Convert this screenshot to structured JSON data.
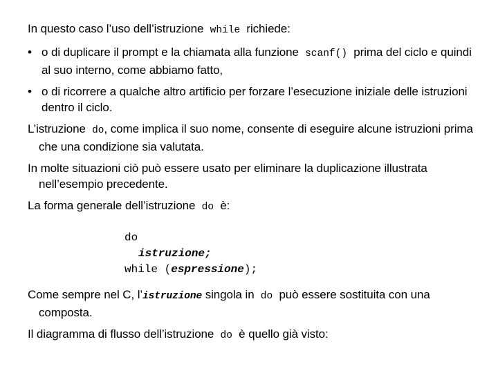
{
  "slide": {
    "background_color": "#ffffff",
    "text_color": "#000000",
    "language": "it",
    "intro": {
      "text_1": "In questo caso l’uso dell’istruzione",
      "code_1": "while",
      "text_2": "richiede:"
    },
    "bullets": [
      {
        "marker": "•",
        "text_1": "o di duplicare il prompt e la chiamata alla funzione",
        "code_1": "scanf()",
        "text_2": "prima del ciclo e quindi al suo interno, come abbiamo fatto,"
      },
      {
        "marker": "•",
        "text_1": "o di ricorrere a qualche altro artificio per forzare l’esecuzione iniziale delle istruzioni dentro il ciclo.",
        "code_1": "",
        "text_2": ""
      }
    ],
    "paragraphs": [
      {
        "text_1": "L’istruzione",
        "code_1": "do",
        "text_2": ", come implica il suo nome, consente di eseguire alcune istruzioni prima che una condizione sia valutata."
      },
      {
        "text_1": "In molte situazioni ciò può essere usato per eliminare la duplicazione illustrata nell’esempio precedente.",
        "code_1": "",
        "text_2": ""
      },
      {
        "text_1": "La forma generale dell’istruzione",
        "code_1": "do",
        "text_2": "è:"
      }
    ],
    "code_block": {
      "line_1_keyword": "do",
      "line_2_placeholder": "istruzione;",
      "line_3_keyword": "while (",
      "line_3_placeholder": "espressione",
      "line_3_tail": ");"
    },
    "closing": [
      {
        "text_1": "Come sempre nel C, l’",
        "code_1": "istruzione",
        "text_2": "singola in",
        "code_2": "do",
        "text_3": "può essere sostituita con una composta."
      },
      {
        "text_1": "Il diagramma di flusso dell’istruzione",
        "code_1": "do",
        "text_2": "è quello già visto:"
      }
    ]
  }
}
